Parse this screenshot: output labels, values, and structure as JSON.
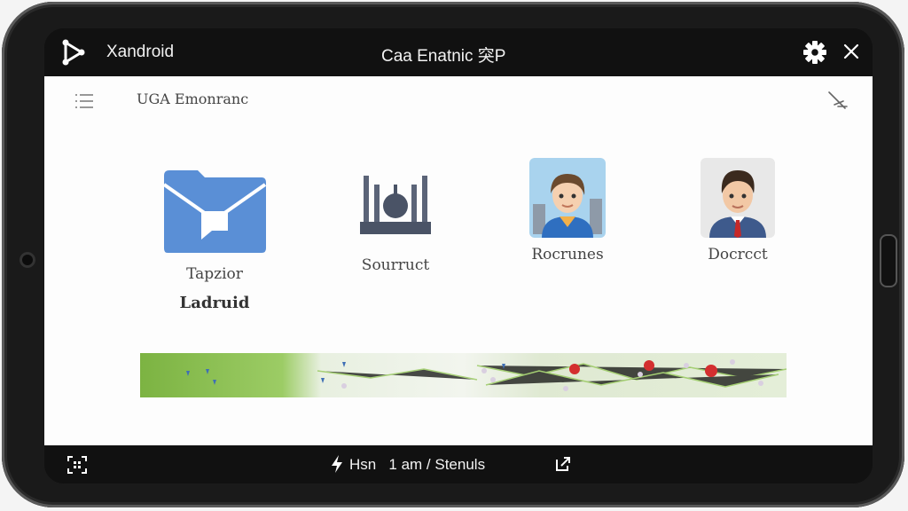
{
  "header": {
    "app_name": "Xandroid",
    "window_title": "Caa Enatnic 突P",
    "icons": [
      "share-logo-icon",
      "gear-icon",
      "close-icon"
    ]
  },
  "content": {
    "title": "UGA Emonranc",
    "tiles": [
      {
        "label": "Tapzior",
        "sublabel": "Ladruid",
        "icon": "mail-folder-icon"
      },
      {
        "label": "Sourruct",
        "icon": "equalizer-icon"
      },
      {
        "label": "Rocrunes",
        "icon": "user-avatar-icon"
      },
      {
        "label": "Docrcct",
        "icon": "user-avatar-icon"
      }
    ]
  },
  "bottom": {
    "status_text": "Hsn   1 am / Stenuls",
    "icons": [
      "qr-scan-icon",
      "bolt-icon",
      "external-link-icon"
    ]
  },
  "colors": {
    "bar": "#111111",
    "folder_blue": "#5a8fd6",
    "strip_green": "#7cb342",
    "pin_red": "#d32f2f"
  }
}
